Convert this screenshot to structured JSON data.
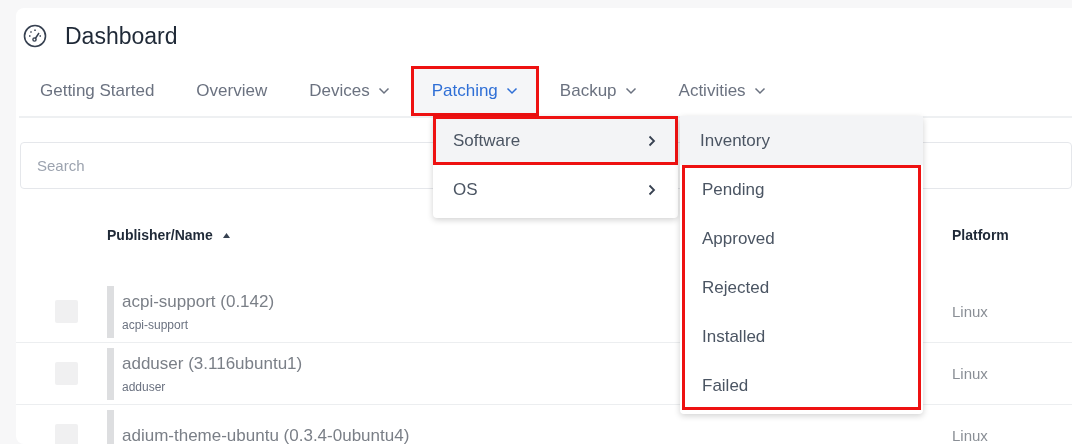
{
  "page": {
    "title": "Dashboard"
  },
  "tabs": [
    {
      "label": "Getting Started",
      "selected": false,
      "dropdown": false,
      "annotated": false
    },
    {
      "label": "Overview",
      "selected": false,
      "dropdown": false,
      "annotated": false
    },
    {
      "label": "Devices",
      "selected": false,
      "dropdown": true,
      "annotated": false
    },
    {
      "label": "Patching",
      "selected": true,
      "dropdown": true,
      "annotated": true
    },
    {
      "label": "Backup",
      "selected": false,
      "dropdown": true,
      "annotated": false
    },
    {
      "label": "Activities",
      "selected": false,
      "dropdown": true,
      "annotated": false
    }
  ],
  "search": {
    "placeholder": "Search"
  },
  "table": {
    "columns": [
      {
        "label": "Publisher/Name",
        "sorted": true
      },
      {
        "label": "Platform",
        "sorted": false
      }
    ],
    "rows": [
      {
        "checked": false,
        "name": "acpi-support (0.142)",
        "package": "acpi-support",
        "platform": "Linux"
      },
      {
        "checked": false,
        "name": "adduser (3.116ubuntu1)",
        "package": "adduser",
        "platform": "Linux"
      },
      {
        "checked": false,
        "name": "adium-theme-ubuntu (0.3.4-0ubuntu4)",
        "platform": "Linux"
      }
    ]
  },
  "menu": {
    "items": [
      {
        "label": "Software",
        "highlighted": true,
        "annotated": true,
        "submenu": true
      },
      {
        "label": "OS",
        "highlighted": false,
        "annotated": false,
        "submenu": true
      }
    ]
  },
  "submenu": {
    "items": [
      {
        "label": "Inventory",
        "highlighted": true,
        "annotated": false
      },
      {
        "label": "Pending",
        "highlighted": false,
        "annotated": true
      },
      {
        "label": "Approved",
        "highlighted": false,
        "annotated": true
      },
      {
        "label": "Rejected",
        "highlighted": false,
        "annotated": true
      },
      {
        "label": "Installed",
        "highlighted": false,
        "annotated": true
      },
      {
        "label": "Failed",
        "highlighted": false,
        "annotated": true
      }
    ]
  }
}
